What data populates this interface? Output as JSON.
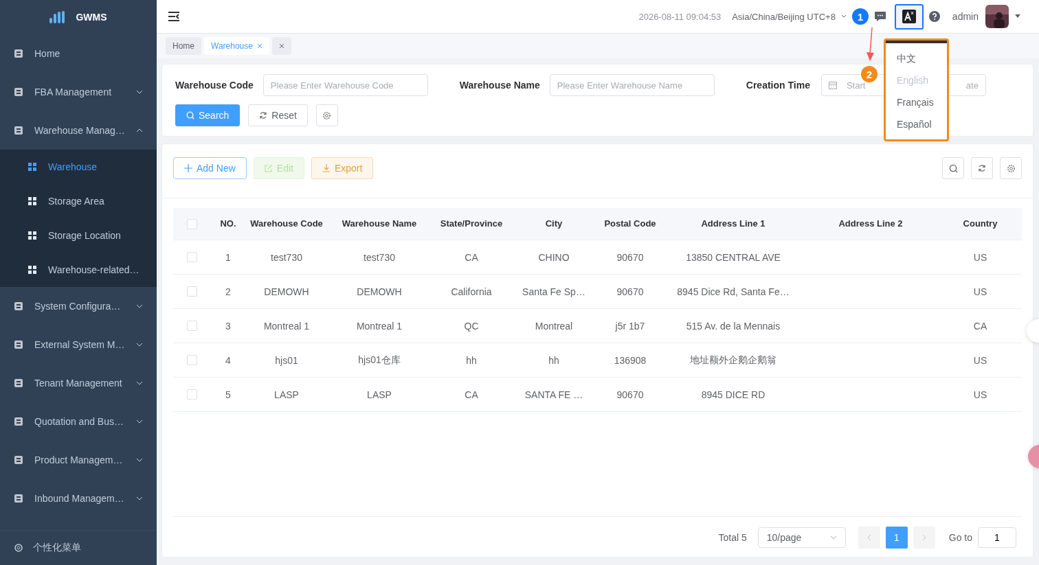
{
  "logo": {
    "text": "GWMS"
  },
  "sidebar": {
    "items": [
      {
        "label": "Home"
      },
      {
        "label": "FBA Management",
        "expanded": false
      },
      {
        "label": "Warehouse Manag…",
        "expanded": true,
        "children": [
          {
            "label": "Warehouse",
            "selected": true
          },
          {
            "label": "Storage Area",
            "selected": false
          },
          {
            "label": "Storage Location",
            "selected": false
          },
          {
            "label": "Warehouse-related…",
            "selected": false
          }
        ]
      },
      {
        "label": "System Configura…",
        "expanded": false
      },
      {
        "label": "External System M…",
        "expanded": false
      },
      {
        "label": "Tenant Management",
        "expanded": false
      },
      {
        "label": "Quotation and Bus…",
        "expanded": false
      },
      {
        "label": "Product Managem…",
        "expanded": false
      },
      {
        "label": "Inbound Managem…",
        "expanded": false
      }
    ],
    "footer": "个性化菜单"
  },
  "header": {
    "datetime": "2026-08-11 09:04:53",
    "timezone": "Asia/China/Beijing UTC+8",
    "user": "admin"
  },
  "language_menu": [
    {
      "label": "中文",
      "selected": false
    },
    {
      "label": "English",
      "selected": true
    },
    {
      "label": "Français",
      "selected": false
    },
    {
      "label": "Español",
      "selected": false
    }
  ],
  "annotations": [
    {
      "label": "1"
    },
    {
      "label": "2"
    }
  ],
  "tabs": [
    {
      "label": "Home",
      "selected": false,
      "closable": false
    },
    {
      "label": "Warehouse",
      "selected": true,
      "closable": true
    }
  ],
  "filters": [
    {
      "label": "Warehouse Code",
      "placeholder": "Please Enter Warehouse Code"
    },
    {
      "label": "Warehouse Name",
      "placeholder": "Please Enter Warehouse Name"
    }
  ],
  "creation_time": {
    "label": "Creation Time",
    "start_placeholder": "Start",
    "end_placeholder": "ate"
  },
  "search_buttons": [
    {
      "label": "Search",
      "kind": "primary"
    },
    {
      "label": "Reset",
      "kind": "default"
    }
  ],
  "toolbar": [
    {
      "label": "Add New",
      "kind": "add"
    },
    {
      "label": "Edit",
      "kind": "edit",
      "disabled": true
    },
    {
      "label": "Export",
      "kind": "export"
    }
  ],
  "table": {
    "select_all_checked": false,
    "columns": [
      "NO.",
      "Warehouse Code",
      "Warehouse Name",
      "State/Province",
      "City",
      "Postal Code",
      "Address Line 1",
      "Address Line 2",
      "Country"
    ],
    "rows": [
      {
        "checked": false,
        "cells": [
          "1",
          "test730",
          "test730",
          "CA",
          "CHINO",
          "90670",
          "13850 CENTRAL AVE",
          "",
          "US"
        ]
      },
      {
        "checked": false,
        "cells": [
          "2",
          "DEMOWH",
          "DEMOWH",
          "California",
          "Santa Fe Sp…",
          "90670",
          "8945 Dice Rd, Santa Fe…",
          "",
          "US"
        ]
      },
      {
        "checked": false,
        "cells": [
          "3",
          "Montreal 1",
          "Montreal 1",
          "QC",
          "Montreal",
          "j5r 1b7",
          "515 Av. de la Mennais",
          "",
          "CA"
        ]
      },
      {
        "checked": false,
        "cells": [
          "4",
          "hjs01",
          "hjs01仓库",
          "hh",
          "hh",
          "136908",
          "地址额外企鹅企鹅翁",
          "",
          "US"
        ]
      },
      {
        "checked": false,
        "cells": [
          "5",
          "LASP",
          "LASP",
          "CA",
          "SANTA FE …",
          "90670",
          "8945 DICE RD",
          "",
          "US"
        ]
      }
    ]
  },
  "pagination": {
    "total": "Total 5",
    "page_size": "10/page",
    "pages": [
      {
        "label": "1",
        "selected": true
      }
    ],
    "goto_label": "Go to",
    "goto_value": "1"
  }
}
